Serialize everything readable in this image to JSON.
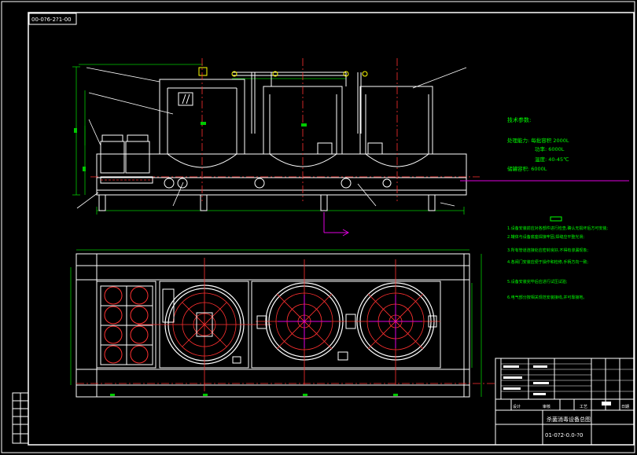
{
  "drawing": {
    "top_left_code": "00-0?6-2?1-00",
    "bottom_right_code": "01-0?2-0.0-?0",
    "notes_heading": "技术参数:",
    "note_lines": [
      "处理能力: 每批容积 2000L",
      "功率: 6000L",
      "温度: 40-45℃",
      "储罐容积: 6000L"
    ],
    "requirements_heading": "技术要求",
    "requirement_lines": [
      "1.设备安装前应对各部件进行检查,确认无损坏后方可安装;",
      "2.罐体与设备底座焊接牢固,焊缝应平整光滑;",
      "3.所有管道连接处应密封良好,不得有渗漏现象;",
      "4.各阀门安装应便于操作和检修,手柄方向一致;",
      "5.设备安装完毕后应进行试压试验;",
      "6.电气部分按相关规范安装接线,并可靠接地。"
    ],
    "title_block": {
      "name": "杀菌消毒设备总图",
      "cells": [
        "设计",
        "审核",
        "工艺",
        "日期"
      ]
    }
  },
  "colors": {
    "frame": "#ffffff",
    "outline": "#ffffff",
    "dim": "#00c800",
    "center": "#ff3030",
    "pipe": "#ffff00",
    "leader": "#e000e0",
    "cyan": "#00e0e0",
    "text": "#00ff00"
  }
}
